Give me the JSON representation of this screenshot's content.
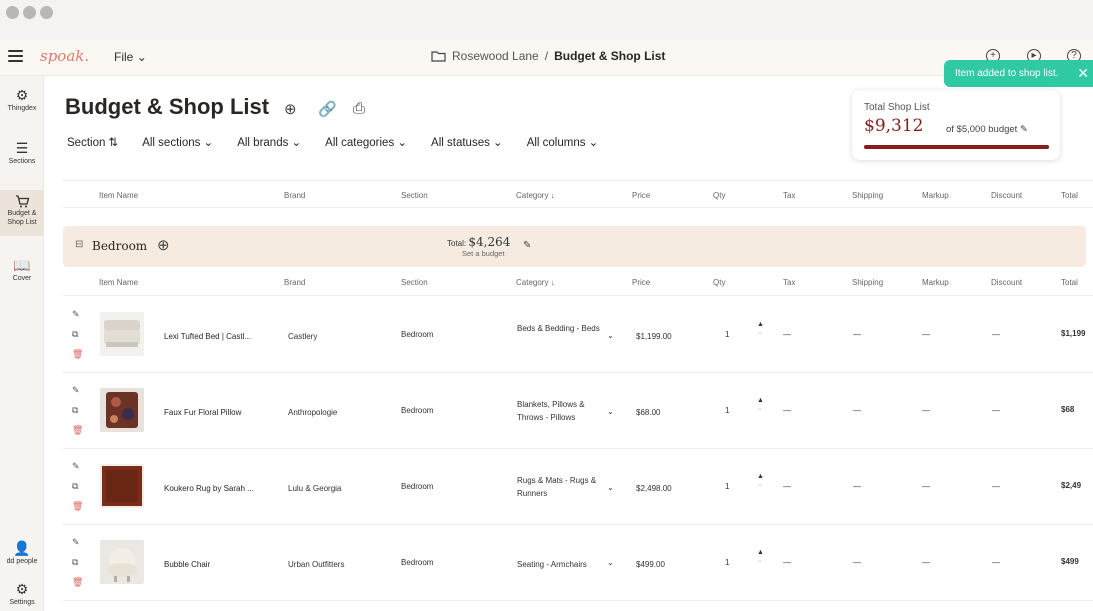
{
  "app": {
    "logo": "spoak."
  },
  "appbar": {
    "file_label": "File",
    "breadcrumb_project": "Rosewood Lane",
    "breadcrumb_sep": "/",
    "breadcrumb_page": "Budget & Shop List"
  },
  "toast": {
    "text": "Item added to shop list."
  },
  "sidebar": {
    "items": [
      {
        "label1": "Thingdex",
        "label2": ""
      },
      {
        "label1": "Sections",
        "label2": ""
      },
      {
        "label1": "Budget &",
        "label2": "Shop List"
      },
      {
        "label1": "Cover",
        "label2": ""
      },
      {
        "label1": "dd people",
        "label2": ""
      },
      {
        "label1": "Settings",
        "label2": ""
      }
    ]
  },
  "page": {
    "title": "Budget & Shop List"
  },
  "filters": [
    "Section ⇅",
    "All sections ⌄",
    "All brands ⌄",
    "All categories ⌄",
    "All statuses ⌄",
    "All columns ⌄"
  ],
  "budget": {
    "label": "Total Shop List",
    "amount": "$9,312",
    "of_text": "of $5,000 budget",
    "progress": 1.0,
    "bar_color": "#8a1c1c"
  },
  "columns": [
    "Item Name",
    "Brand",
    "Section",
    "Category ↓",
    "Price",
    "Qty",
    "Tax",
    "Shipping",
    "Markup",
    "Discount",
    "Total"
  ],
  "section": {
    "name": "Bedroom",
    "total_label": "Total:",
    "total": "$4,264",
    "set_budget": "Set a budget"
  },
  "rows": [
    {
      "name": "Lexi Tufted Bed | Castl...",
      "brand": "Castlery",
      "section": "Bedroom",
      "category": "Beds & Bedding - Beds",
      "price": "$1,199.00",
      "qty": "1",
      "tax": "—",
      "shipping": "—",
      "markup": "—",
      "discount": "—",
      "total": "$1,199"
    },
    {
      "name": "Faux Fur Floral Pillow",
      "brand": "Anthropologie",
      "section": "Bedroom",
      "category": "Blankets, Pillows & Throws - Pillows",
      "price": "$68.00",
      "qty": "1",
      "tax": "—",
      "shipping": "—",
      "markup": "—",
      "discount": "—",
      "total": "$68"
    },
    {
      "name": "Koukero Rug by Sarah ...",
      "brand": "Lulu & Georgia",
      "section": "Bedroom",
      "category": "Rugs & Mats - Rugs & Runners",
      "price": "$2,498.00",
      "qty": "1",
      "tax": "—",
      "shipping": "—",
      "markup": "—",
      "discount": "—",
      "total": "$2,49"
    },
    {
      "name": "Bubble Chair",
      "brand": "Urban Outfitters",
      "section": "Bedroom",
      "category": "Seating - Armchairs",
      "price": "$499.00",
      "qty": "1",
      "tax": "—",
      "shipping": "—",
      "markup": "—",
      "discount": "—",
      "total": "$499"
    }
  ]
}
